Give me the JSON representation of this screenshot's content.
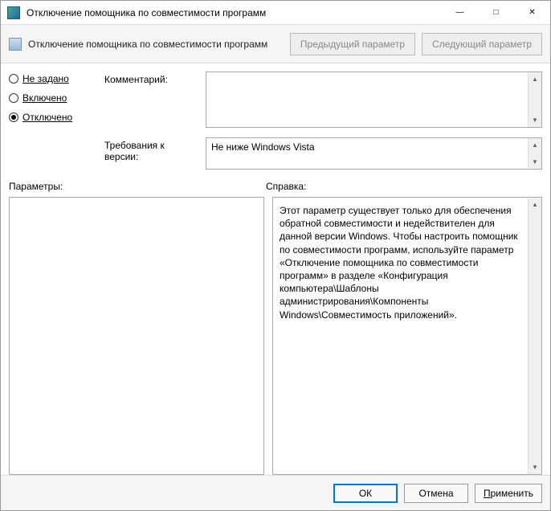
{
  "window": {
    "title": "Отключение помощника по совместимости программ"
  },
  "subheader": {
    "title": "Отключение помощника по совместимости программ",
    "prev": "Предыдущий параметр",
    "next": "Следующий параметр"
  },
  "radios": {
    "not_configured": "Не задано",
    "enabled": "Включено",
    "disabled": "Отключено",
    "selected": "disabled"
  },
  "fields": {
    "comment_label": "Комментарий:",
    "comment_value": "",
    "version_label": "Требования к версии:",
    "version_value": "Не ниже Windows Vista"
  },
  "labels": {
    "params": "Параметры:",
    "help": "Справка:"
  },
  "help_text": "Этот параметр существует только для обеспечения обратной совместимости и недействителен для данной версии Windows. Чтобы настроить помощник по совместимости программ, используйте параметр «Отключение помощника по совместимости программ» в разделе «Конфигурация компьютера\\Шаблоны администрирования\\Компоненты Windows\\Совместимость приложений».",
  "footer": {
    "ok": "ОК",
    "cancel": "Отмена",
    "apply": "Применить",
    "apply_ul": "П",
    "apply_rest": "рименить"
  }
}
